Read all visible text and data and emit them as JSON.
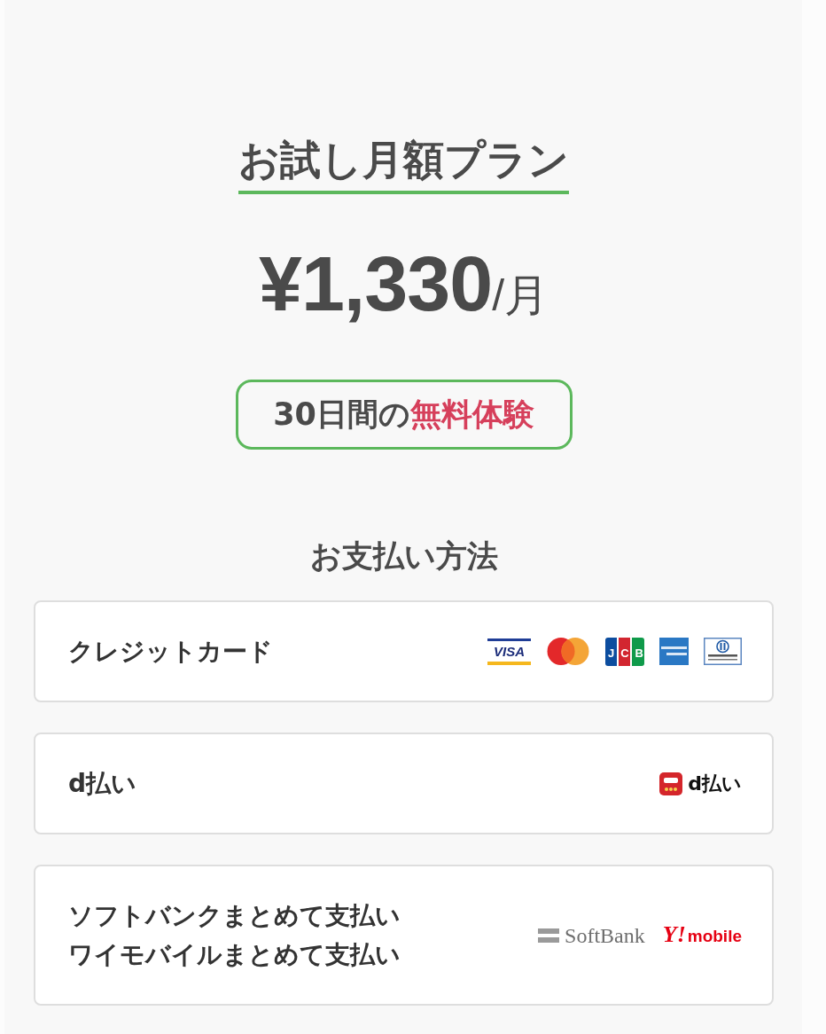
{
  "plan": {
    "title": "お試し月額プラン",
    "price": "**¥1,330**/月",
    "trial_badge": "30日間の**無料体験**"
  },
  "payment": {
    "heading": "お支払い方法",
    "methods": [
      {
        "lines": [
          "クレジットカード"
        ],
        "logos": [
          {
            "kind": "visa",
            "text": "VISA"
          },
          {
            "kind": "mastercard"
          },
          {
            "kind": "jcb",
            "text": "JCB"
          },
          {
            "kind": "amex"
          },
          {
            "kind": "diners"
          }
        ]
      },
      {
        "lines": [
          "d払い"
        ],
        "logos": [
          {
            "kind": "dpay",
            "text": "d払い"
          }
        ]
      },
      {
        "lines": [
          "ソフトバンクまとめて支払い",
          "ワイモバイルまとめて支払い"
        ],
        "logos": [
          {
            "kind": "softbank",
            "text": "SoftBank"
          },
          {
            "kind": "ymobile",
            "mark": "Y!",
            "text": "mobile"
          }
        ]
      }
    ]
  }
}
